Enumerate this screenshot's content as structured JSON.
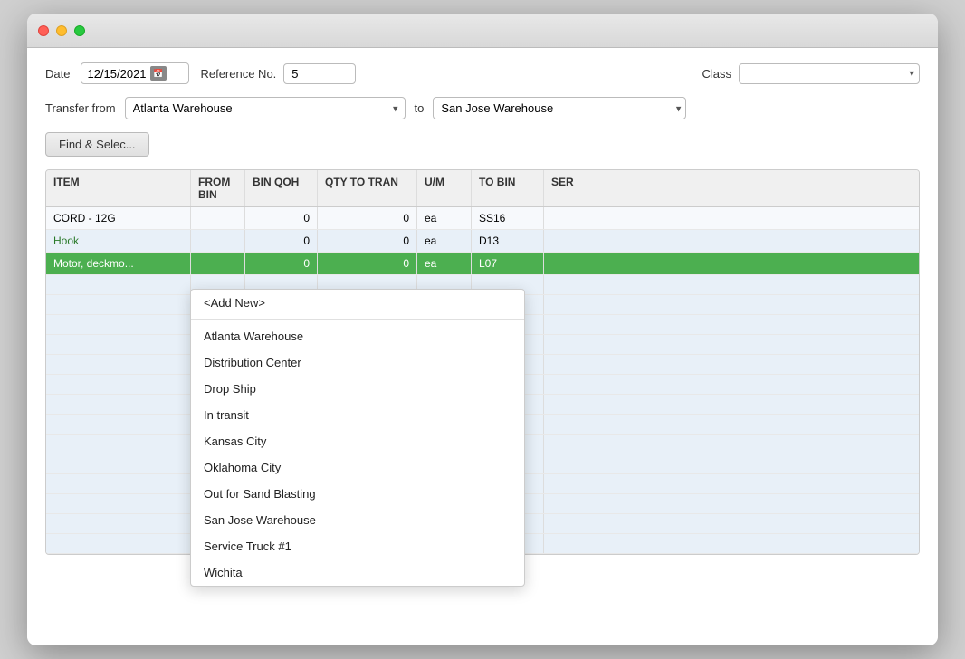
{
  "titlebar": {
    "buttons": [
      "close",
      "minimize",
      "maximize"
    ]
  },
  "form": {
    "date_label": "Date",
    "date_value": "12/15/2021",
    "ref_label": "Reference No.",
    "ref_value": "5",
    "class_label": "Class",
    "class_placeholder": "",
    "transfer_from_label": "Transfer from",
    "transfer_from_value": "Atlanta Warehouse",
    "to_label": "to",
    "transfer_to_value": "San Jose Warehouse",
    "find_select_btn": "Find & Selec..."
  },
  "dropdown": {
    "options": [
      {
        "id": "add-new",
        "label": "<Add New>",
        "type": "add-new"
      },
      {
        "id": "atlanta",
        "label": "Atlanta Warehouse"
      },
      {
        "id": "distribution",
        "label": "Distribution Center"
      },
      {
        "id": "drop-ship",
        "label": "Drop Ship"
      },
      {
        "id": "in-transit",
        "label": "In transit"
      },
      {
        "id": "kansas-city",
        "label": "Kansas City"
      },
      {
        "id": "oklahoma-city",
        "label": "Oklahoma City"
      },
      {
        "id": "out-for-sand",
        "label": "Out for Sand Blasting"
      },
      {
        "id": "san-jose",
        "label": "San Jose Warehouse"
      },
      {
        "id": "service-truck",
        "label": "Service Truck #1"
      },
      {
        "id": "wichita",
        "label": "Wichita"
      }
    ]
  },
  "table": {
    "headers": [
      "ITEM",
      "FROM BIN",
      "BIN QOH",
      "QTY TO TRAN",
      "U/M",
      "TO BIN",
      "SER"
    ],
    "rows": [
      {
        "item": "CORD - 12G",
        "from_bin": "",
        "bin_qoh": "0",
        "qty_to_tran": "0",
        "um": "ea",
        "to_bin": "SS16",
        "ser": "",
        "highlight": false,
        "green_item": false
      },
      {
        "item": "Hook",
        "from_bin": "",
        "bin_qoh": "0",
        "qty_to_tran": "0",
        "um": "ea",
        "to_bin": "D13",
        "ser": "",
        "highlight": false,
        "green_item": true
      },
      {
        "item": "Motor, deckmo...",
        "from_bin": "",
        "bin_qoh": "0",
        "qty_to_tran": "0",
        "um": "ea",
        "to_bin": "L07",
        "ser": "",
        "highlight": true,
        "green_item": false
      }
    ],
    "empty_rows": 14
  }
}
